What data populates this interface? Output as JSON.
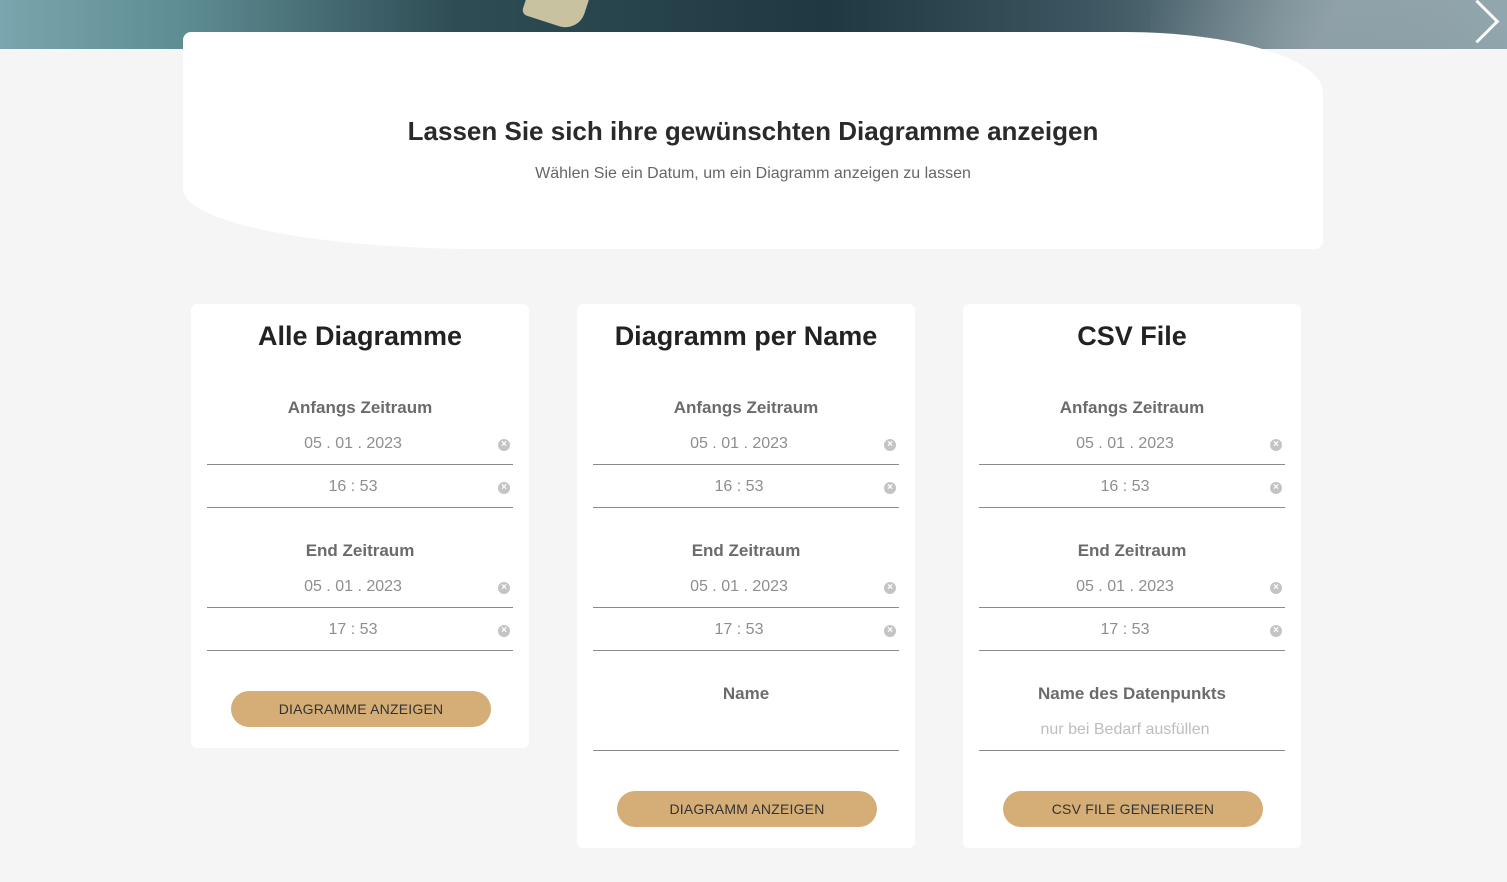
{
  "hero": {
    "next_icon": "chevron-right-icon"
  },
  "intro": {
    "title": "Lassen Sie sich ihre gewünschten Diagramme anzeigen",
    "subtitle": "Wählen Sie ein Datum, um ein Diagramm anzeigen zu lassen"
  },
  "cards": [
    {
      "title": "Alle Diagramme",
      "start_label": "Anfangs Zeitraum",
      "start_date": "05 . 01 . 2023",
      "start_time": "16 : 53",
      "end_label": "End Zeitraum",
      "end_date": "05 . 01 . 2023",
      "end_time": "17 : 53",
      "button": "DIAGRAMME ANZEIGEN"
    },
    {
      "title": "Diagramm per Name",
      "start_label": "Anfangs Zeitraum",
      "start_date": "05 . 01 . 2023",
      "start_time": "16 : 53",
      "end_label": "End Zeitraum",
      "end_date": "05 . 01 . 2023",
      "end_time": "17 : 53",
      "name_label": "Name",
      "name_value": "",
      "button": "DIAGRAMM ANZEIGEN"
    },
    {
      "title": "CSV File",
      "start_label": "Anfangs Zeitraum",
      "start_date": "05 . 01 . 2023",
      "start_time": "16 : 53",
      "end_label": "End Zeitraum",
      "end_date": "05 . 01 . 2023",
      "end_time": "17 : 53",
      "name_label": "Name des Datenpunkts",
      "name_placeholder": "nur bei Bedarf ausfüllen",
      "button": "CSV FILE GENERIEREN"
    }
  ],
  "icons": {
    "clear": "clear-icon",
    "clear_glyph": "×"
  },
  "colors": {
    "button": "#d4ae76",
    "background": "#f5f5f5",
    "card": "#ffffff"
  }
}
